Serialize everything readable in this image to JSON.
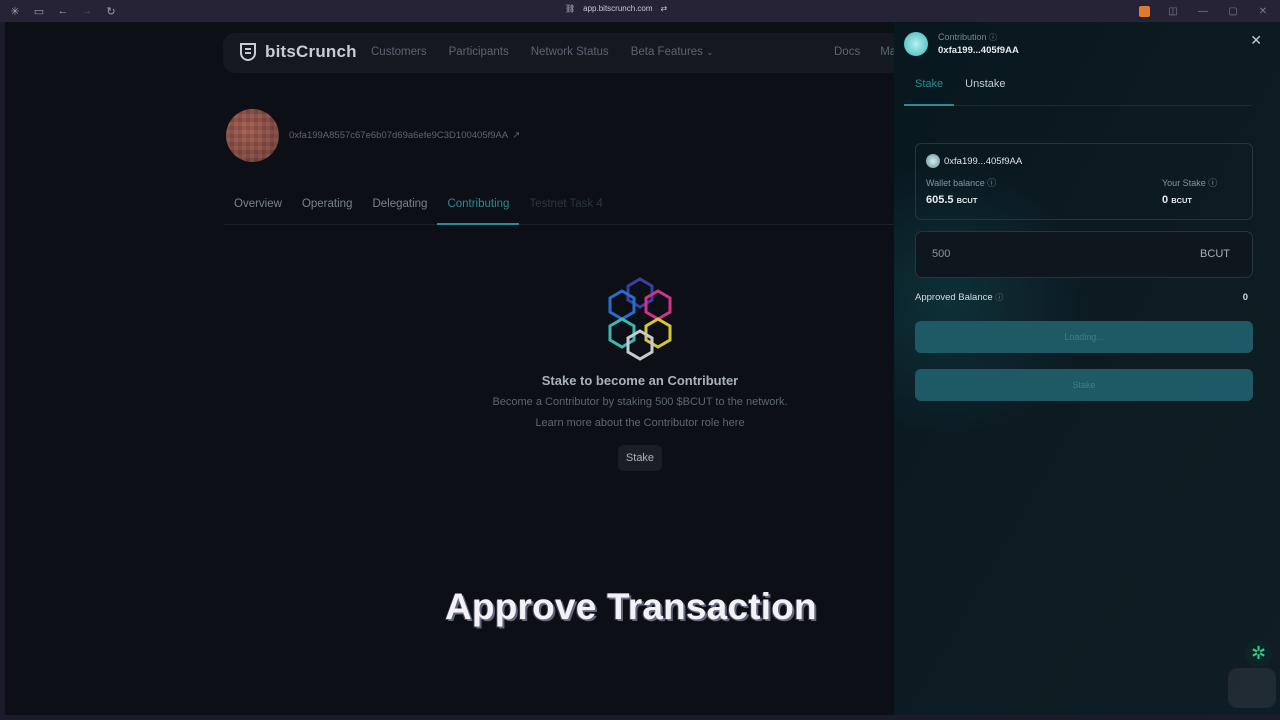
{
  "browser": {
    "url": "app.bitscrunch.com"
  },
  "nav": {
    "brand": "bitsCrunch",
    "items": [
      "Customers",
      "Participants",
      "Network Status",
      "Beta Features"
    ],
    "right_items": [
      "Docs",
      "Ma"
    ]
  },
  "profile": {
    "address": "0xfa199A8557c67e6b07d69a6efe9C3D100405f9AA"
  },
  "tabs": [
    "Overview",
    "Operating",
    "Delegating",
    "Contributing",
    "Testnet Task 4"
  ],
  "empty_state": {
    "title": "Stake to become an Contributer",
    "subtitle": "Become a Contributor by staking 500 $BCUT to the network.",
    "link": "Learn more about the Contributor role here",
    "button": "Stake"
  },
  "caption": "Approve Transaction",
  "panel": {
    "label": "Contribution",
    "address": "0xfa199...405f9AA",
    "tabs": [
      "Stake",
      "Unstake"
    ],
    "card": {
      "address": "0xfa199...405f9AA",
      "wallet_label": "Wallet balance",
      "wallet_value": "605.5",
      "stake_label": "Your Stake",
      "stake_value": "0",
      "unit": "BCUT"
    },
    "amount_value": "500",
    "amount_unit": "BCUT",
    "approved_label": "Approved Balance",
    "approved_value": "0",
    "loading_button": "Loading...",
    "stake_button": "Stake"
  }
}
